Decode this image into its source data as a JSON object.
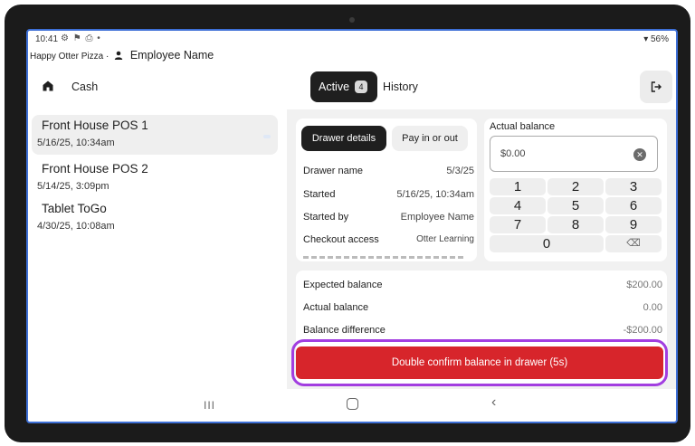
{
  "status_bar": {
    "time": "10:41",
    "icons": "⚙ ⚑ ⎙ •",
    "battery": "▾ 56%"
  },
  "app": {
    "restaurant": "Happy Otter Pizza",
    "separator": "·",
    "employee": "Employee Name"
  },
  "header": {
    "title": "Cash",
    "active_tab": "Active",
    "active_count": "4",
    "history_tab": "History"
  },
  "drawers": [
    {
      "name": "Front House POS 1",
      "time": "5/16/25, 10:34am",
      "selected": true
    },
    {
      "name": "Front House POS 2",
      "time": "5/14/25, 3:09pm",
      "selected": false
    },
    {
      "name": "Tablet ToGo",
      "time": "4/30/25, 10:08am",
      "selected": false
    }
  ],
  "details": {
    "tab_details": "Drawer details",
    "tab_pay": "Pay in or out",
    "rows": [
      {
        "label": "Drawer name",
        "value": "5/3/25"
      },
      {
        "label": "Started",
        "value": "5/16/25, 10:34am"
      },
      {
        "label": "Started by",
        "value": "Employee Name"
      },
      {
        "label": "Checkout access",
        "value": "Otter Learning"
      }
    ]
  },
  "balance": {
    "label": "Actual balance",
    "value": "$0.00",
    "keys": [
      "1",
      "2",
      "3",
      "4",
      "5",
      "6",
      "7",
      "8",
      "9",
      "0",
      "⌫"
    ]
  },
  "summary": {
    "rows": [
      {
        "label": "Expected balance",
        "value": "$200.00"
      },
      {
        "label": "Actual balance",
        "value": "0.00"
      },
      {
        "label": "Balance difference",
        "value": "-$200.00"
      }
    ]
  },
  "confirm_button": "Double confirm balance in drawer (5s)",
  "nav": {
    "recent": "III",
    "back": "‹"
  },
  "colors": {
    "accent_red": "#d7252b",
    "highlight_purple": "#a23ee0",
    "screen_border": "#3d6fd6"
  }
}
